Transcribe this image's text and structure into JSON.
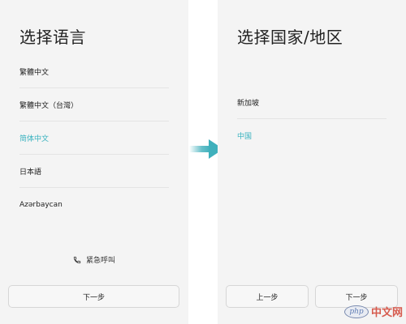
{
  "language_screen": {
    "title": "选择语言",
    "items": [
      {
        "label": "繁體中文",
        "selected": false
      },
      {
        "label": "繁體中文（台灣）",
        "selected": false
      },
      {
        "label": "简体中文",
        "selected": true
      },
      {
        "label": "日本語",
        "selected": false
      },
      {
        "label": "Azərbaycan",
        "selected": false
      }
    ],
    "emergency_label": "紧急呼叫",
    "next_label": "下一步"
  },
  "region_screen": {
    "title": "选择国家/地区",
    "items": [
      {
        "label": "新加坡",
        "selected": false
      },
      {
        "label": "中国",
        "selected": true
      }
    ],
    "prev_label": "上一步",
    "next_label": "下一步"
  },
  "watermark": {
    "logo_text": "php",
    "site_text": "中文网"
  },
  "colors": {
    "accent": "#38b2bf",
    "panel_bg": "#f4f4f4",
    "arrow": "#3fb0bc"
  }
}
